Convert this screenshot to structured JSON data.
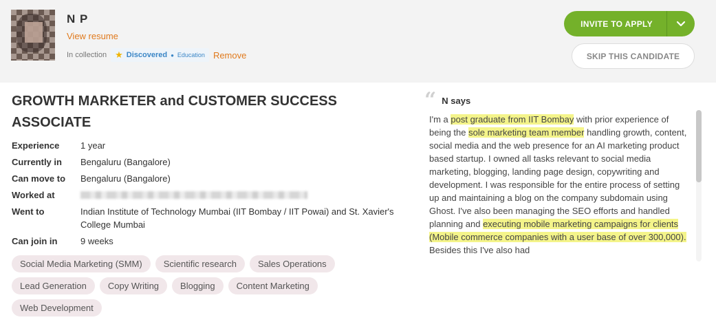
{
  "candidate": {
    "name": "N P",
    "view_resume": "View resume",
    "collection_prefix": "In collection",
    "tag": {
      "label": "Discovered",
      "sub": "Education",
      "star_icon": "star-icon"
    },
    "remove": "Remove"
  },
  "actions": {
    "invite": "INVITE TO APPLY",
    "skip": "SKIP THIS CANDIDATE"
  },
  "job_title": "GROWTH MARKETER and CUSTOMER SUCCESS ASSOCIATE",
  "facts": [
    {
      "label": "Experience",
      "value": "1 year"
    },
    {
      "label": "Currently in",
      "value": "Bengaluru (Bangalore)"
    },
    {
      "label": "Can move to",
      "value": "Bengaluru (Bangalore)"
    },
    {
      "label": "Worked at",
      "value": ""
    },
    {
      "label": "Went to",
      "value": "Indian Institute of Technology Mumbai (IIT Bombay / IIT Powai) and St. Xavier's College Mumbai"
    },
    {
      "label": "Can join in",
      "value": "9 weeks"
    }
  ],
  "skills": [
    "Social Media Marketing (SMM)",
    "Scientific research",
    "Sales Operations",
    "Lead Generation",
    "Copy Writing",
    "Blogging",
    "Content Marketing",
    "Web Development"
  ],
  "summary": {
    "heading": "N says",
    "parts": [
      {
        "t": "I'm a ",
        "h": false
      },
      {
        "t": "post graduate from IIT Bombay",
        "h": true
      },
      {
        "t": " with prior experience of being the ",
        "h": false
      },
      {
        "t": "sole marketing team member",
        "h": true
      },
      {
        "t": " handling growth, content, social media and the web presence for an AI marketing product based startup. I owned all tasks relevant to social media marketing, blogging, landing page design, copywriting and development. I was responsible for the entire process of setting up and maintaining a blog on the company subdomain using Ghost. I've also been managing the SEO efforts and handled planning and ",
        "h": false
      },
      {
        "t": "executing mobile marketing campaigns for clients (Mobile commerce companies with a user base of over 300,000).",
        "h": true
      },
      {
        "t": " Besides this I've also had",
        "h": false
      }
    ]
  },
  "colors": {
    "accent_green": "#74b12a",
    "link_orange": "#e07a1d",
    "tag_blue": "#3b86c6",
    "highlight": "#f4f48a",
    "skill_bg": "#f1e7ea"
  }
}
